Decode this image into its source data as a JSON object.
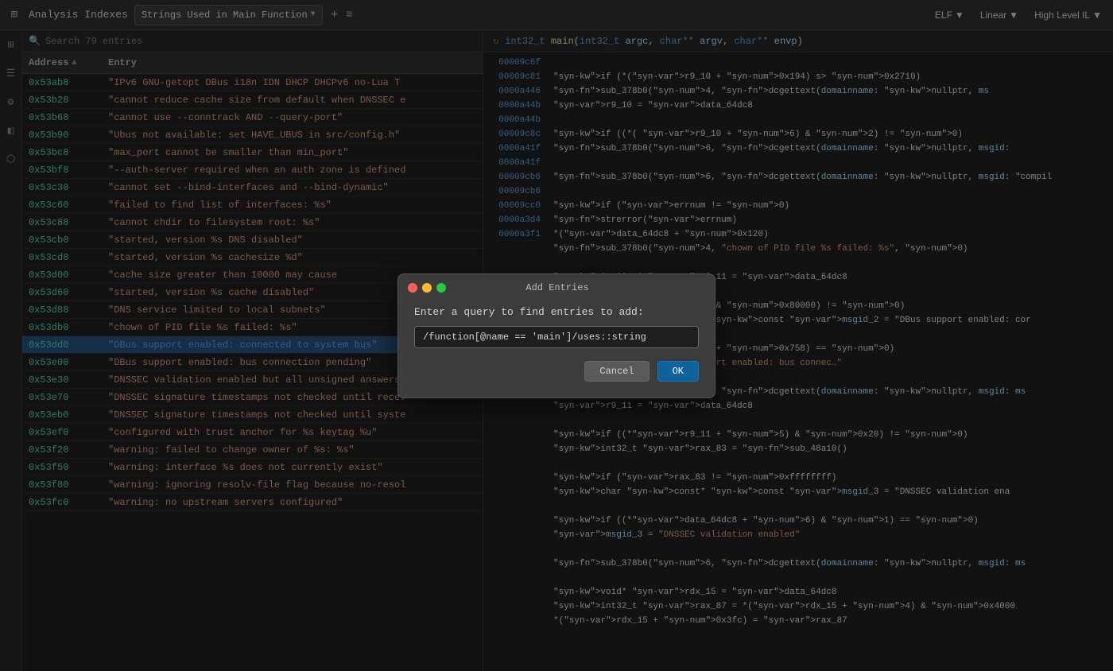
{
  "topbar": {
    "icon": "⊞",
    "analysis_label": "Analysis Indexes",
    "dropdown_value": "Strings Used in Main Function",
    "plus": "+",
    "dots": "≡",
    "elf_label": "ELF",
    "linear_label": "Linear",
    "highil_label": "High Level IL"
  },
  "search": {
    "placeholder": "Search 79 entries",
    "icon": "🔍"
  },
  "table": {
    "col_address": "Address",
    "col_entry": "Entry",
    "rows": [
      {
        "address": "0x53ab8",
        "entry": "\"IPv6 GNU-getopt DBus i18n IDN DHCP DHCPv6 no-Lua T",
        "highlighted": false
      },
      {
        "address": "0x53b28",
        "entry": "\"cannot reduce cache size from default when DNSSEC e",
        "highlighted": false
      },
      {
        "address": "0x53b68",
        "entry": "\"cannot use --conntrack AND --query-port\"",
        "highlighted": false
      },
      {
        "address": "0x53b90",
        "entry": "\"Ubus not available: set HAVE_UBUS in src/config.h\"",
        "highlighted": false
      },
      {
        "address": "0x53bc8",
        "entry": "\"max_port cannot be smaller than min_port\"",
        "highlighted": false
      },
      {
        "address": "0x53bf8",
        "entry": "\"--auth-server required when an auth zone is defined",
        "highlighted": false
      },
      {
        "address": "0x53c30",
        "entry": "\"cannot set --bind-interfaces and --bind-dynamic\"",
        "highlighted": false
      },
      {
        "address": "0x53c60",
        "entry": "\"failed to find list of interfaces: %s\"",
        "highlighted": false
      },
      {
        "address": "0x53c88",
        "entry": "\"cannot chdir to filesystem root: %s\"",
        "highlighted": false
      },
      {
        "address": "0x53cb0",
        "entry": "\"started, version %s DNS disabled\"",
        "highlighted": false
      },
      {
        "address": "0x53cd8",
        "entry": "\"started, version %s cachesize %d\"",
        "highlighted": false
      },
      {
        "address": "0x53d00",
        "entry": "\"cache size greater than 10000 may cause",
        "highlighted": false
      },
      {
        "address": "0x53d60",
        "entry": "\"started, version %s cache disabled\"",
        "highlighted": false
      },
      {
        "address": "0x53d88",
        "entry": "\"DNS service limited to local subnets\"",
        "highlighted": false
      },
      {
        "address": "0x53db0",
        "entry": "\"chown of PID file %s failed: %s\"",
        "highlighted": false
      },
      {
        "address": "0x53dd0",
        "entry": "\"DBus support enabled: connected to system bus\"",
        "highlighted": true
      },
      {
        "address": "0x53e00",
        "entry": "\"DBus support enabled: bus connection pending\"",
        "highlighted": false
      },
      {
        "address": "0x53e30",
        "entry": "\"DNSSEC validation enabled but all unsigned answers",
        "highlighted": false
      },
      {
        "address": "0x53e70",
        "entry": "\"DNSSEC signature timestamps not checked until rece:",
        "highlighted": false
      },
      {
        "address": "0x53eb0",
        "entry": "\"DNSSEC signature timestamps not checked until syste",
        "highlighted": false
      },
      {
        "address": "0x53ef0",
        "entry": "\"configured with trust anchor for %s keytag %u\"",
        "highlighted": false
      },
      {
        "address": "0x53f20",
        "entry": "\"warning: failed to change owner of %s: %s\"",
        "highlighted": false
      },
      {
        "address": "0x53f50",
        "entry": "\"warning: interface %s does not currently exist\"",
        "highlighted": false
      },
      {
        "address": "0x53f80",
        "entry": "\"warning: ignoring resolv-file flag because no-resol",
        "highlighted": false
      },
      {
        "address": "0x53fc0",
        "entry": "\"warning: no upstream servers configured\"",
        "highlighted": false
      }
    ]
  },
  "code_header": {
    "func_sig": "int32_t main(int32_t argc, char** argv, char** envp)"
  },
  "code_lines": [
    {
      "addr": "00009c6f",
      "code": ""
    },
    {
      "addr": "00009c81",
      "code": "if (*(r9_10 + 0x194) s> 0x2710)"
    },
    {
      "addr": "0000a446",
      "code": "    sub_378b0(4, dcgettext(domainname: nullptr, ms"
    },
    {
      "addr": "0000a44b",
      "code": "    r9_10 = data_64dc8"
    },
    {
      "addr": "0000a44b",
      "code": ""
    },
    {
      "addr": "00009c8c",
      "code": "if ((*( r9_10 + 6) & 2) != 0)"
    },
    {
      "addr": "0000a41f",
      "code": "    sub_378b0(6, dcgettext(domainname: nullptr, msgid:"
    },
    {
      "addr": "0000a41f",
      "code": ""
    },
    {
      "addr": "00009cb6",
      "code": "sub_378b0(6, dcgettext(domainname: nullptr, msgid: \"compil"
    },
    {
      "addr": "00009cb6",
      "code": ""
    },
    {
      "addr": "00009cc0",
      "code": "if (errnum != 0)"
    },
    {
      "addr": "0000a3d4",
      "code": "    strerror(errnum)"
    },
    {
      "addr": "0000a3f1",
      "code": "    *(data_64dc8 + 0x120)"
    },
    {
      "addr": "",
      "code": "    sub_378b0(4, \"chown of PID file %s failed: %s\", 0)"
    },
    {
      "addr": "",
      "code": ""
    },
    {
      "addr": "",
      "code": "int32_t* r9_11 = data_64dc8"
    },
    {
      "addr": "",
      "code": ""
    },
    {
      "addr": "",
      "code": "if ((*r9_11 & 0x80000) != 0)"
    },
    {
      "addr": "",
      "code": "    char const* const msgid_2 = \"DBus support enabled: cor"
    },
    {
      "addr": "",
      "code": ""
    },
    {
      "addr": "",
      "code": "    if (*(r9_11 + 0x758) == 0)"
    },
    {
      "addr": "",
      "code": "        msgid_2 = \"DBus support enabled: bus connec…\""
    },
    {
      "addr": "",
      "code": ""
    },
    {
      "addr": "",
      "code": "    sub_378b0(6, dcgettext(domainname: nullptr, msgid: ms"
    },
    {
      "addr": "",
      "code": "    r9_11 = data_64dc8"
    },
    {
      "addr": "",
      "code": ""
    },
    {
      "addr": "",
      "code": "if ((*r9_11 + 5) & 0x20) != 0)"
    },
    {
      "addr": "",
      "code": "    int32_t rax_83 = sub_48a10()"
    },
    {
      "addr": "",
      "code": ""
    },
    {
      "addr": "",
      "code": "    if (rax_83 != 0xffffffff)"
    },
    {
      "addr": "",
      "code": "        char const* const msgid_3 = \"DNSSEC validation ena"
    },
    {
      "addr": "",
      "code": ""
    },
    {
      "addr": "",
      "code": "        if ((*data_64dc8 + 6) & 1) == 0)"
    },
    {
      "addr": "",
      "code": "            msgid_3 = \"DNSSEC validation enabled\""
    },
    {
      "addr": "",
      "code": ""
    },
    {
      "addr": "",
      "code": "    sub_378b0(6, dcgettext(domainname: nullptr, msgid: ms"
    },
    {
      "addr": "",
      "code": ""
    },
    {
      "addr": "",
      "code": "    void* rdx_15 = data_64dc8"
    },
    {
      "addr": "",
      "code": "    int32_t rax_87 = *(rdx_15 + 4) & 0x4000"
    },
    {
      "addr": "",
      "code": "    *(rdx_15 + 0x3fc) = rax_87"
    }
  ],
  "dialog": {
    "title": "Add Entries",
    "label": "Enter a query to find entries to add:",
    "input_value": "/function[@name == 'main']/uses::string",
    "cancel_label": "Cancel",
    "ok_label": "OK"
  }
}
